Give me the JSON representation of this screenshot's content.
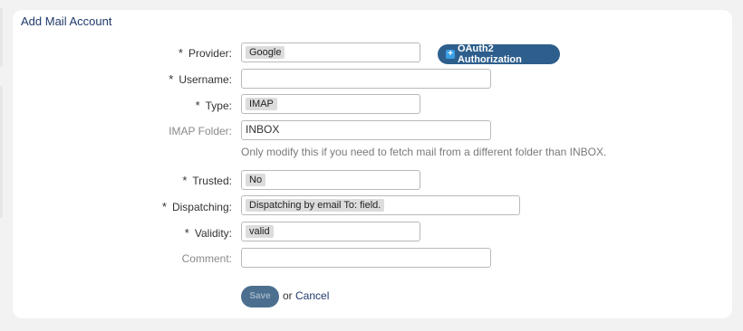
{
  "panel": {
    "title": "Add Mail Account"
  },
  "form": {
    "provider": {
      "label": "Provider:",
      "required": true,
      "value": "Google"
    },
    "oauth_button": {
      "label": "OAuth2 Authorization"
    },
    "username": {
      "label": "Username:",
      "required": true,
      "value": ""
    },
    "type": {
      "label": "Type:",
      "required": true,
      "value": "IMAP"
    },
    "imap_folder": {
      "label": "IMAP Folder:",
      "required": false,
      "value": "INBOX",
      "hint": "Only modify this if you need to fetch mail from a different folder than INBOX."
    },
    "trusted": {
      "label": "Trusted:",
      "required": true,
      "value": "No"
    },
    "dispatching": {
      "label": "Dispatching:",
      "required": true,
      "value": "Dispatching by email To: field."
    },
    "validity": {
      "label": "Validity:",
      "required": true,
      "value": "valid"
    },
    "comment": {
      "label": "Comment:",
      "required": false,
      "value": ""
    },
    "required_marker": "*"
  },
  "actions": {
    "save_label": "Save",
    "or_text": "or",
    "cancel_label": "Cancel"
  },
  "icons": {
    "oauth_icon": "plus-icon"
  },
  "colors": {
    "primary_button": "#2e5f8c",
    "link": "#1f3a6b",
    "plus_icon": "#3aa0e6"
  }
}
